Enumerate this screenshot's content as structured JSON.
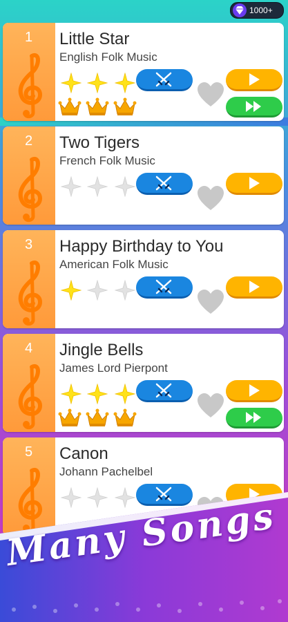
{
  "topbar": {
    "gem_icon": "diamond-icon",
    "gem_count": "1000+"
  },
  "songs": [
    {
      "number": "1",
      "title": "Little Star",
      "artist": "English Folk Music",
      "stars": 3,
      "crowns": 3,
      "fast_forward": true
    },
    {
      "number": "2",
      "title": "Two Tigers",
      "artist": "French Folk Music",
      "stars": 0,
      "crowns": 0,
      "fast_forward": false
    },
    {
      "number": "3",
      "title": "Happy Birthday to You",
      "artist": "American Folk Music",
      "stars": 1,
      "crowns": 0,
      "fast_forward": false
    },
    {
      "number": "4",
      "title": "Jingle Bells",
      "artist": "James Lord Pierpont",
      "stars": 3,
      "crowns": 3,
      "fast_forward": true
    },
    {
      "number": "5",
      "title": "Canon",
      "artist": "Johann Pachelbel",
      "stars": 0,
      "crowns": 0,
      "fast_forward": false
    }
  ],
  "banner": {
    "text": "Many Songs"
  },
  "colors": {
    "star_filled": "#ffe21a",
    "star_empty": "#e2e2e2",
    "crown": "#f7a600",
    "battle_button": "#1a86e0",
    "play_button": "#ffb400",
    "fast_forward_button": "#2ecc4a",
    "card_left": "#ff9a3a",
    "heart": "#c8c8c8"
  }
}
